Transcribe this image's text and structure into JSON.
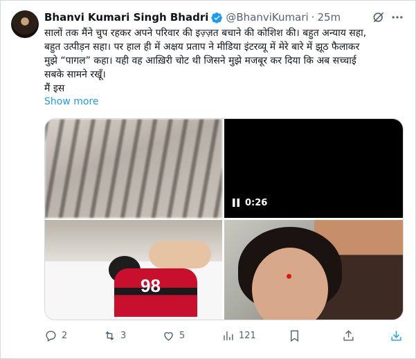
{
  "tweet": {
    "author_name": "Bhanvi Kumari Singh Bhadri",
    "handle": "@BhanviKumari",
    "separator": "·",
    "time": "25m",
    "text": "सालों तक मैंने चुप रहकर अपने परिवार की इज़्ज़त बचाने की कोशिश की। बहुत अन्याय सहा,\nबहुत उत्पीड़न सहा। पर हाल ही में अक्षय प्रताप ने मीडिया इंटरव्यू में मेरे बारे में झूठ फैलाकर\nमुझे “पागल” कहा। यही वह आख़िरी चोट थी जिसने मुझे मजबूर कर दिया कि अब सच्चाई\nसबके सामने रखूँ।\nमैं इस",
    "show_more": "Show more"
  },
  "media": {
    "video_time": "0:26",
    "jersey_number": "98"
  },
  "actions": {
    "replies": "2",
    "reposts": "3",
    "likes": "5",
    "views": "121"
  },
  "colors": {
    "accent": "#1d9bf0",
    "secondary_text": "#536471",
    "primary_text": "#0f1419"
  },
  "icons": [
    "verified-badge-icon",
    "grok-icon",
    "more-icon",
    "pause-icon",
    "reply-icon",
    "repost-icon",
    "like-icon",
    "views-icon",
    "bookmark-icon",
    "share-icon"
  ]
}
